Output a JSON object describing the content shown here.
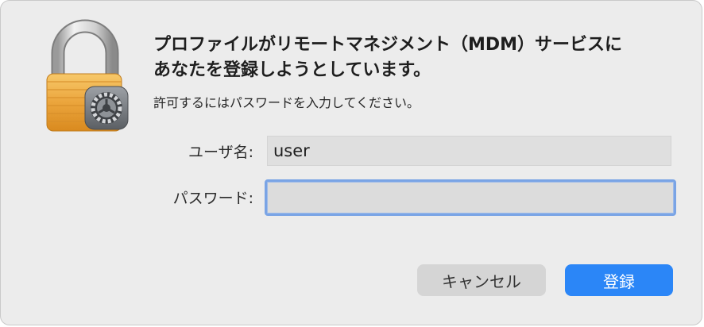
{
  "dialog": {
    "heading_line1": "プロファイルがリモートマネジメント（MDM）サービスに",
    "heading_line2": "あなたを登録しようとしています。",
    "instruction": "許可するにはパスワードを入力してください。",
    "icon": "lock-with-gear-icon"
  },
  "form": {
    "username_label": "ユーザ名:",
    "username_value": "user",
    "password_label": "パスワード:",
    "password_value": ""
  },
  "buttons": {
    "cancel_label": "キャンセル",
    "submit_label": "登録"
  },
  "colors": {
    "accent": "#2b86f7",
    "focus_ring": "#7aa4e5",
    "background": "#ececec"
  }
}
